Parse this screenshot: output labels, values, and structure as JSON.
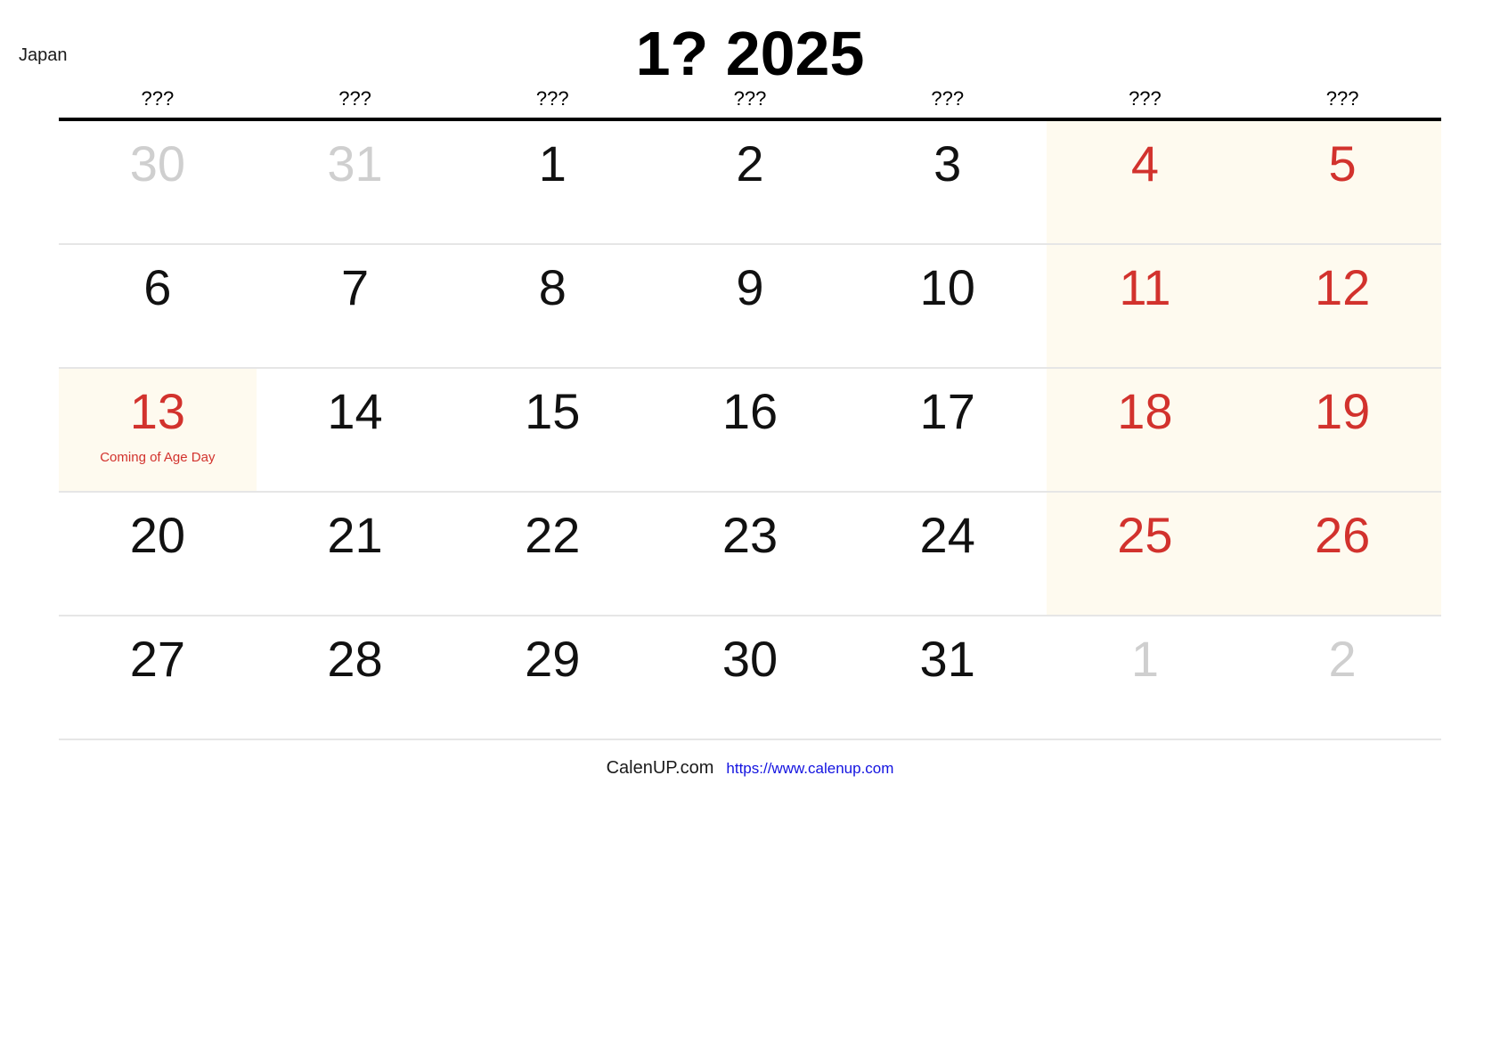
{
  "header": {
    "country": "Japan",
    "title": "1? 2025"
  },
  "weekdays": [
    {
      "label": "???",
      "kind": "weekday"
    },
    {
      "label": "???",
      "kind": "weekday"
    },
    {
      "label": "???",
      "kind": "weekday"
    },
    {
      "label": "???",
      "kind": "weekday"
    },
    {
      "label": "???",
      "kind": "weekday"
    },
    {
      "label": "???",
      "kind": "saturday"
    },
    {
      "label": "???",
      "kind": "sunday"
    }
  ],
  "colors": {
    "weekend_background": "#fefaef",
    "weekend_text": "#d2322d",
    "adjacent_month_text": "#cfcfcf",
    "normal_text": "#111111",
    "header_rule": "#000000",
    "row_divider": "#e6e6e6",
    "link": "#1313e0"
  },
  "weeks": [
    {
      "days": [
        {
          "num": "30",
          "style": "muted",
          "shaded": false,
          "holiday": ""
        },
        {
          "num": "31",
          "style": "muted",
          "shaded": false,
          "holiday": ""
        },
        {
          "num": "1",
          "style": "normal",
          "shaded": false,
          "holiday": ""
        },
        {
          "num": "2",
          "style": "normal",
          "shaded": false,
          "holiday": ""
        },
        {
          "num": "3",
          "style": "normal",
          "shaded": false,
          "holiday": ""
        },
        {
          "num": "4",
          "style": "red",
          "shaded": true,
          "holiday": ""
        },
        {
          "num": "5",
          "style": "red",
          "shaded": true,
          "holiday": ""
        }
      ]
    },
    {
      "days": [
        {
          "num": "6",
          "style": "normal",
          "shaded": false,
          "holiday": ""
        },
        {
          "num": "7",
          "style": "normal",
          "shaded": false,
          "holiday": ""
        },
        {
          "num": "8",
          "style": "normal",
          "shaded": false,
          "holiday": ""
        },
        {
          "num": "9",
          "style": "normal",
          "shaded": false,
          "holiday": ""
        },
        {
          "num": "10",
          "style": "normal",
          "shaded": false,
          "holiday": ""
        },
        {
          "num": "11",
          "style": "red",
          "shaded": true,
          "holiday": ""
        },
        {
          "num": "12",
          "style": "red",
          "shaded": true,
          "holiday": ""
        }
      ]
    },
    {
      "days": [
        {
          "num": "13",
          "style": "red",
          "shaded": true,
          "holiday": "Coming of Age Day"
        },
        {
          "num": "14",
          "style": "normal",
          "shaded": false,
          "holiday": ""
        },
        {
          "num": "15",
          "style": "normal",
          "shaded": false,
          "holiday": ""
        },
        {
          "num": "16",
          "style": "normal",
          "shaded": false,
          "holiday": ""
        },
        {
          "num": "17",
          "style": "normal",
          "shaded": false,
          "holiday": ""
        },
        {
          "num": "18",
          "style": "red",
          "shaded": true,
          "holiday": ""
        },
        {
          "num": "19",
          "style": "red",
          "shaded": true,
          "holiday": ""
        }
      ]
    },
    {
      "days": [
        {
          "num": "20",
          "style": "normal",
          "shaded": false,
          "holiday": ""
        },
        {
          "num": "21",
          "style": "normal",
          "shaded": false,
          "holiday": ""
        },
        {
          "num": "22",
          "style": "normal",
          "shaded": false,
          "holiday": ""
        },
        {
          "num": "23",
          "style": "normal",
          "shaded": false,
          "holiday": ""
        },
        {
          "num": "24",
          "style": "normal",
          "shaded": false,
          "holiday": ""
        },
        {
          "num": "25",
          "style": "red",
          "shaded": true,
          "holiday": ""
        },
        {
          "num": "26",
          "style": "red",
          "shaded": true,
          "holiday": ""
        }
      ]
    },
    {
      "days": [
        {
          "num": "27",
          "style": "normal",
          "shaded": false,
          "holiday": ""
        },
        {
          "num": "28",
          "style": "normal",
          "shaded": false,
          "holiday": ""
        },
        {
          "num": "29",
          "style": "normal",
          "shaded": false,
          "holiday": ""
        },
        {
          "num": "30",
          "style": "normal",
          "shaded": false,
          "holiday": ""
        },
        {
          "num": "31",
          "style": "normal",
          "shaded": false,
          "holiday": ""
        },
        {
          "num": "1",
          "style": "muted",
          "shaded": false,
          "holiday": ""
        },
        {
          "num": "2",
          "style": "muted",
          "shaded": false,
          "holiday": ""
        }
      ]
    }
  ],
  "footer": {
    "brand": "CalenUP.com",
    "url": "https://www.calenup.com"
  }
}
